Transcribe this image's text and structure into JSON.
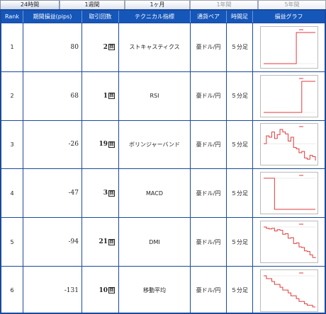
{
  "tabs": [
    {
      "label": "24時間",
      "state": "active"
    },
    {
      "label": "1週間",
      "state": "normal"
    },
    {
      "label": "1ヶ月",
      "state": "normal"
    },
    {
      "label": "1年間",
      "state": "disabled"
    },
    {
      "label": "5年間",
      "state": "disabled"
    }
  ],
  "columns": {
    "rank": "Rank",
    "pips": "期間損益(pips)",
    "count": "取引回数",
    "indicator": "テクニカル指標",
    "pair": "通貨ペア",
    "timeframe": "時間足",
    "graph": "損益グラフ"
  },
  "count_unit": "回",
  "colors": {
    "header_bg": "#1556b9",
    "border": "#1a4a9c",
    "graph_line": "#e23b3b"
  },
  "rows": [
    {
      "rank": "1",
      "pips": "80",
      "count": "2",
      "indicator": "ストキャスティクス",
      "pair": "豪ドル/円",
      "timeframe": "５分足",
      "graph": [
        0,
        0,
        0,
        0,
        0,
        0,
        0,
        0,
        0,
        0,
        0,
        0,
        80,
        80,
        80,
        80,
        80,
        80,
        80,
        80
      ]
    },
    {
      "rank": "2",
      "pips": "68",
      "count": "1",
      "indicator": "RSI",
      "pair": "豪ドル/円",
      "timeframe": "５分足",
      "graph": [
        0,
        0,
        0,
        0,
        0,
        0,
        0,
        0,
        0,
        0,
        0,
        0,
        0,
        0,
        68,
        68,
        68,
        68,
        68,
        68
      ]
    },
    {
      "rank": "3",
      "pips": "-26",
      "count": "19",
      "indicator": "ボリンジャーバンド",
      "pair": "豪ドル/円",
      "timeframe": "５分足",
      "graph": [
        0,
        12,
        10,
        18,
        8,
        14,
        22,
        18,
        15,
        4,
        10,
        -6,
        -8,
        -14,
        -12,
        -22,
        -24,
        -18,
        -20,
        -26
      ]
    },
    {
      "rank": "4",
      "pips": "-47",
      "count": "3",
      "indicator": "MACD",
      "pair": "豪ドル/円",
      "timeframe": "５分足",
      "graph": [
        0,
        0,
        0,
        0,
        -47,
        -47,
        -47,
        -47,
        -47,
        -47,
        -47,
        -47,
        -47,
        -47,
        -47,
        -47,
        -47,
        -47,
        -47,
        -47
      ]
    },
    {
      "rank": "5",
      "pips": "-94",
      "count": "21",
      "indicator": "DMI",
      "pair": "豪ドル/円",
      "timeframe": "５分足",
      "graph": [
        0,
        -4,
        -6,
        -4,
        -12,
        -8,
        -10,
        -22,
        -20,
        -34,
        -32,
        -50,
        -48,
        -60,
        -62,
        -72,
        -74,
        -84,
        -92,
        -94
      ]
    },
    {
      "rank": "6",
      "pips": "-131",
      "count": "10",
      "indicator": "移動平均",
      "pair": "豪ドル/円",
      "timeframe": "５分足",
      "graph": [
        0,
        -12,
        -12,
        -24,
        -36,
        -36,
        -48,
        -60,
        -60,
        -72,
        -84,
        -84,
        -96,
        -108,
        -108,
        -118,
        -124,
        -124,
        -131,
        -131
      ]
    }
  ]
}
